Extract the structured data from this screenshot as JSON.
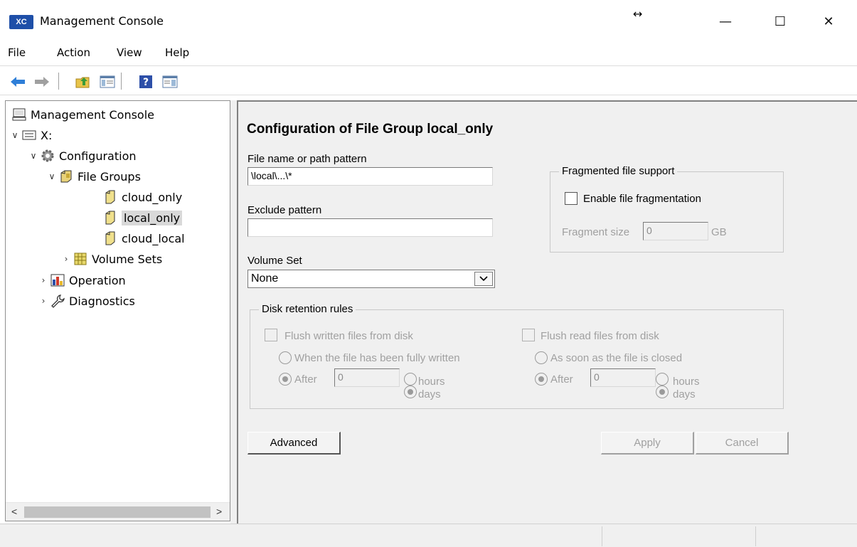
{
  "window": {
    "icon_text": "XC",
    "title": "Management Console",
    "resize_glyph": "↔",
    "minimize": "—",
    "maximize": "☐",
    "close": "✕"
  },
  "menu": [
    "File",
    "Action",
    "View",
    "Help"
  ],
  "toolbar": {
    "icons": [
      "back-arrow-icon",
      "forward-arrow-icon",
      "up-folder-icon",
      "show-hide-tree-icon",
      "help-icon",
      "action-pane-icon"
    ],
    "colors": {
      "back": "#2f7fd8",
      "forward": "#a0a0a0",
      "help": "#2d4fa8"
    }
  },
  "tree": {
    "root": "Management Console",
    "drive": "X:",
    "configuration": "Configuration",
    "file_groups": "File Groups",
    "groups": [
      "cloud_only",
      "local_only",
      "cloud_local"
    ],
    "volume_sets": "Volume Sets",
    "operation": "Operation",
    "diagnostics": "Diagnostics",
    "selected": "local_only"
  },
  "form": {
    "heading": "Configuration of File Group local_only",
    "file_pattern_label": "File name or path pattern",
    "file_pattern_value": "\\local\\...\\*",
    "exclude_label": "Exclude pattern",
    "exclude_value": "",
    "volume_set_label": "Volume Set",
    "volume_set_value": "None",
    "fragment_group": "Fragmented file support",
    "fragment_enable": "Enable file fragmentation",
    "fragment_size_label": "Fragment size",
    "fragment_size_value": "0",
    "fragment_unit": "GB",
    "retention_group": "Disk retention rules",
    "flush_written": "Flush written files from disk",
    "when_written": "When the file has been fully written",
    "flush_read": "Flush read files from disk",
    "when_closed": "As soon as the file is closed",
    "after": "After",
    "after_value_written": "0",
    "after_value_read": "0",
    "hours": "hours",
    "days": "days",
    "advanced_button": "Advanced",
    "apply_button": "Apply",
    "cancel_button": "Cancel"
  }
}
